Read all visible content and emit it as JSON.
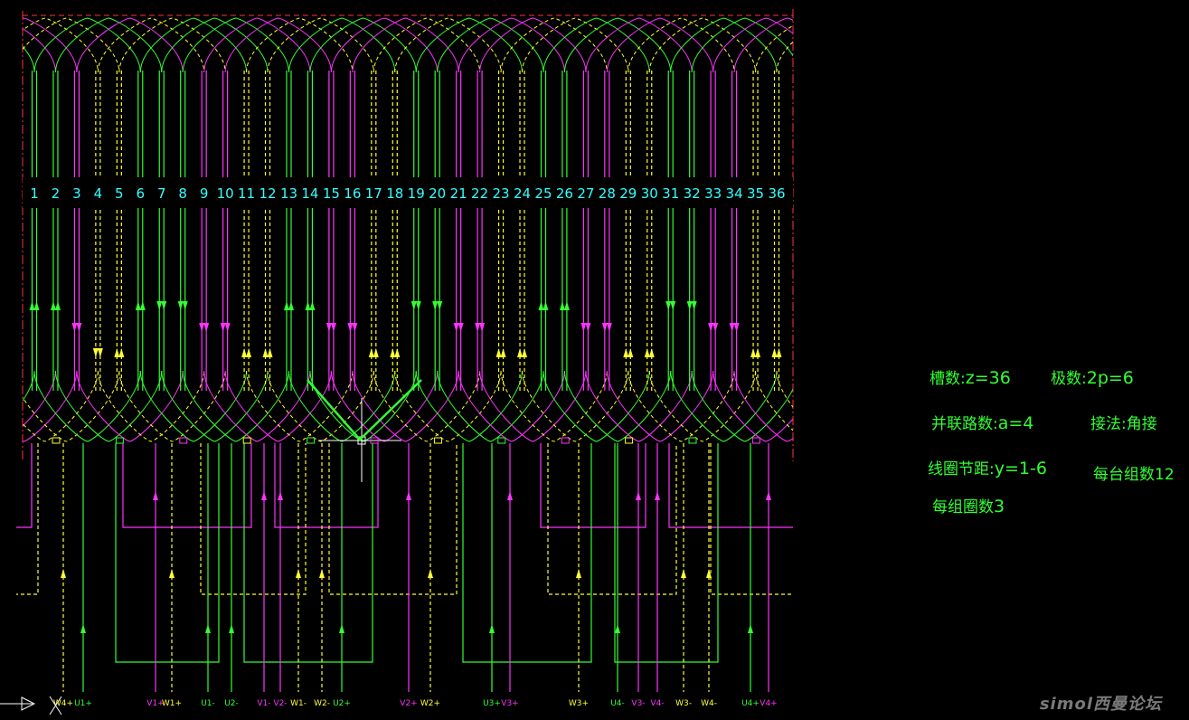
{
  "colors": {
    "background": "#000000",
    "phase_u": "#33ff33",
    "phase_v": "#ff33ff",
    "phase_w": "#ffff33",
    "slot_label": "#33ffff",
    "border": "#ff3333",
    "info_text": "#33ff33"
  },
  "slots": [
    "1",
    "2",
    "3",
    "4",
    "5",
    "6",
    "7",
    "8",
    "9",
    "10",
    "11",
    "12",
    "13",
    "14",
    "15",
    "16",
    "17",
    "18",
    "19",
    "20",
    "21",
    "22",
    "23",
    "24",
    "25",
    "26",
    "27",
    "28",
    "29",
    "30",
    "31",
    "32",
    "33",
    "34",
    "35",
    "36"
  ],
  "slot_phase": [
    "U",
    "U",
    "V",
    "W",
    "W",
    "U",
    "U",
    "U",
    "V",
    "V",
    "W",
    "W",
    "U",
    "U",
    "V",
    "V",
    "W",
    "W",
    "U",
    "U",
    "V",
    "V",
    "W",
    "W",
    "U",
    "U",
    "V",
    "V",
    "W",
    "W",
    "U",
    "U",
    "V",
    "V",
    "W",
    "W"
  ],
  "slot_direction": [
    "up",
    "up",
    "down",
    "down",
    "up",
    "up",
    "down",
    "down",
    "down",
    "down",
    "up",
    "up",
    "up",
    "up",
    "down",
    "down",
    "up",
    "up",
    "down",
    "down",
    "down",
    "down",
    "up",
    "up",
    "up",
    "up",
    "down",
    "down",
    "up",
    "up",
    "down",
    "down",
    "down",
    "down",
    "up",
    "up"
  ],
  "terminals": [
    {
      "label": "W4+",
      "phase": "W"
    },
    {
      "label": "U1+",
      "phase": "U"
    },
    {
      "label": "V1+",
      "phase": "V"
    },
    {
      "label": "W1+",
      "phase": "W"
    },
    {
      "label": "U1-",
      "phase": "U"
    },
    {
      "label": "U2-",
      "phase": "U"
    },
    {
      "label": "V1-",
      "phase": "V"
    },
    {
      "label": "V2-",
      "phase": "V"
    },
    {
      "label": "W1-",
      "phase": "W"
    },
    {
      "label": "W2-",
      "phase": "W"
    },
    {
      "label": "U2+",
      "phase": "U"
    },
    {
      "label": "V2+",
      "phase": "V"
    },
    {
      "label": "W2+",
      "phase": "W"
    },
    {
      "label": "U3+",
      "phase": "U"
    },
    {
      "label": "V3+",
      "phase": "V"
    },
    {
      "label": "W3+",
      "phase": "W"
    },
    {
      "label": "U4-",
      "phase": "U"
    },
    {
      "label": "V3-",
      "phase": "V"
    },
    {
      "label": "V4-",
      "phase": "V"
    },
    {
      "label": "W3-",
      "phase": "W"
    },
    {
      "label": "W4-",
      "phase": "W"
    },
    {
      "label": "U4+",
      "phase": "U"
    },
    {
      "label": "V4+",
      "phase": "V"
    }
  ],
  "info": {
    "slots_label": "槽数:",
    "slots_value": "z=36",
    "poles_label": "极数:",
    "poles_value": "2p=6",
    "parallel_label": "并联路数:",
    "parallel_value": "a=4",
    "connection_label": "接法:",
    "connection_value": "角接",
    "pitch_label": "线圈节距:",
    "pitch_value": "y=1-6",
    "groups_text": "每台组数12",
    "coils_per_group_label": "每组圈数",
    "coils_per_group_value": "3"
  },
  "watermark": "simol西曼论坛"
}
